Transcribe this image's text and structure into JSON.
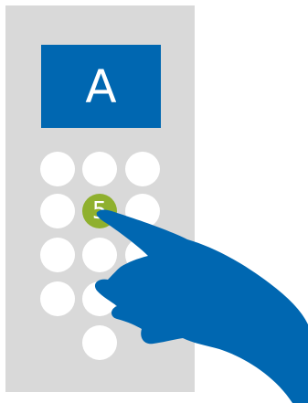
{
  "display": {
    "letter": "A",
    "color": "#0067b1"
  },
  "keypad": {
    "pressed_key": "5",
    "pressed_color": "#8fb02e",
    "key_color": "#ffffff"
  },
  "panel_color": "#d9d9d9",
  "hand_color": "#0067b1",
  "hand_icon": "pointing-hand-icon"
}
